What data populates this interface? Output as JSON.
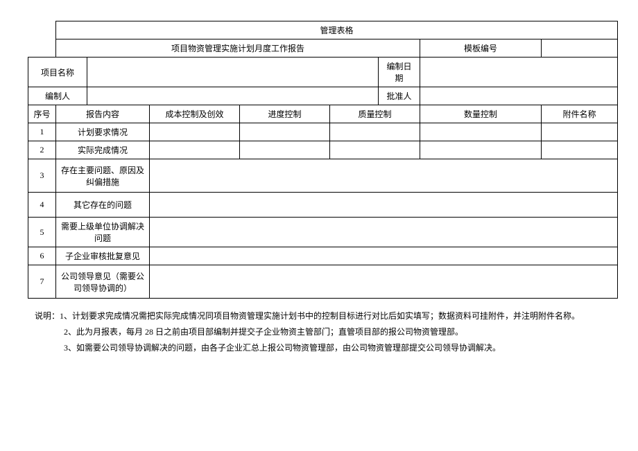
{
  "header": {
    "title1": "管理表格",
    "title2": "项目物资管理实施计划月度工作报告",
    "template_no_label": "模板编号",
    "template_no_value": ""
  },
  "meta": {
    "project_name_label": "项目名称",
    "project_name_value": "",
    "compile_date_label": "编制日期",
    "compile_date_value": "",
    "compiler_label": "编制人",
    "compiler_value": "",
    "approver_label": "批准人",
    "approver_value": ""
  },
  "columns": {
    "seq": "序号",
    "content": "报告内容",
    "cost": "成本控制及创效",
    "schedule": "进度控制",
    "quality": "质量控制",
    "quantity": "数量控制",
    "attachment": "附件名称"
  },
  "rows": [
    {
      "seq": "1",
      "content": "计划要求情况",
      "cost": "",
      "schedule": "",
      "quality": "",
      "quantity": "",
      "attachment": ""
    },
    {
      "seq": "2",
      "content": "实际完成情况",
      "cost": "",
      "schedule": "",
      "quality": "",
      "quantity": "",
      "attachment": ""
    },
    {
      "seq": "3",
      "content": "存在主要问题、原因及纠偏措施",
      "merged": ""
    },
    {
      "seq": "4",
      "content": "其它存在的问题",
      "merged": ""
    },
    {
      "seq": "5",
      "content": "需要上级单位协调解决问题",
      "merged": ""
    },
    {
      "seq": "6",
      "content": "子企业审核批复意见",
      "merged": ""
    },
    {
      "seq": "7",
      "content": "公司领导意见（需要公司领导协调的）",
      "merged": ""
    }
  ],
  "notes": {
    "prefix": "说明：",
    "items": [
      "1、计划要求完成情况需把实际完成情况同项目物资管理实施计划书中的控制目标进行对比后如实填写；数据资料可挂附件，并注明附件名称。",
      "2、此为月报表，每月 28 日之前由项目部编制并提交子企业物资主管部门；直管项目部的报公司物资管理部。",
      "3、如需要公司领导协调解决的问题，由各子企业汇总上报公司物资管理部，由公司物资管理部提交公司领导协调解决。"
    ]
  }
}
